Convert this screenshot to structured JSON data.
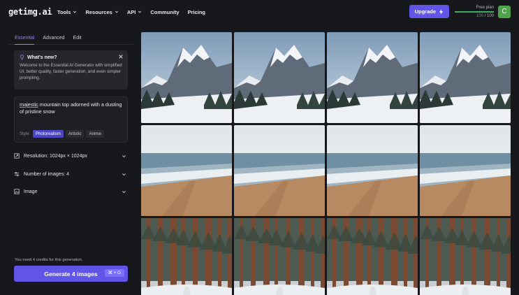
{
  "brand": {
    "logo": "getimg.ai"
  },
  "nav": [
    {
      "label": "Tools",
      "dropdown": true
    },
    {
      "label": "Resources",
      "dropdown": true
    },
    {
      "label": "API",
      "dropdown": true
    },
    {
      "label": "Community",
      "dropdown": false
    },
    {
      "label": "Pricing",
      "dropdown": false
    }
  ],
  "account": {
    "upgrade_label": "Upgrade",
    "plan_name": "Free plan",
    "credits_used": "100",
    "credits_sep": " / ",
    "credits_total": "100",
    "credits_fraction": 1.0,
    "avatar_letter": "C"
  },
  "sidebar": {
    "tabs": [
      {
        "label": "Essential",
        "active": true
      },
      {
        "label": "Advanced",
        "active": false
      },
      {
        "label": "Edit",
        "active": false
      }
    ],
    "whats_new": {
      "title": "What's new?",
      "body": "Welcome to the Essential AI Generator with simplified UI, better quality, faster generation, and even simpler prompting."
    },
    "prompt": {
      "first_word": "majestic",
      "rest": " mountain top adorned with a dusting of pristine snow"
    },
    "style": {
      "label": "Style",
      "options": [
        {
          "label": "Photorealism",
          "active": true
        },
        {
          "label": "Artistic",
          "active": false
        },
        {
          "label": "Anime",
          "active": false
        }
      ]
    },
    "settings": [
      {
        "label": "Resolution: 1024px × 1024px",
        "icon": "resize-icon"
      },
      {
        "label": "Number of images: 4",
        "icon": "sliders-icon"
      },
      {
        "label": "Image",
        "icon": "image-icon"
      }
    ],
    "credit_note": "You need 4 credits for this generation.",
    "generate_label": "Generate 4 images",
    "shortcut": "⌘ + G"
  },
  "colors": {
    "accent": "#6055e6",
    "credits_green": "#3fae62",
    "avatar_green": "#4fa24a"
  },
  "gallery": [
    {
      "scene": "mountain"
    },
    {
      "scene": "mountain"
    },
    {
      "scene": "mountain"
    },
    {
      "scene": "mountain"
    },
    {
      "scene": "beach"
    },
    {
      "scene": "beach"
    },
    {
      "scene": "beach"
    },
    {
      "scene": "beach"
    },
    {
      "scene": "forest"
    },
    {
      "scene": "forest"
    },
    {
      "scene": "forest"
    },
    {
      "scene": "forest"
    }
  ]
}
